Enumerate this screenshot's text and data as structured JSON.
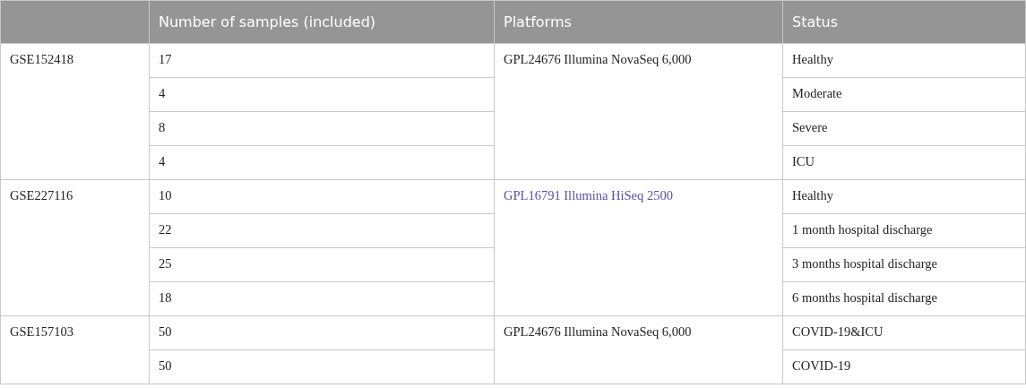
{
  "table": {
    "columns": [
      "Number of samples (included)",
      "Platforms",
      "Status"
    ],
    "groups": [
      {
        "series": "GSE152418",
        "platform": {
          "text": "GPL24676 Illumina NovaSeq 6,000",
          "kind": "text"
        },
        "rows": [
          {
            "samples": "17",
            "status": "Healthy"
          },
          {
            "samples": "4",
            "status": "Moderate"
          },
          {
            "samples": "8",
            "status": "Severe"
          },
          {
            "samples": "4",
            "status": "ICU"
          }
        ]
      },
      {
        "series": "GSE227116",
        "platform": {
          "text": "GPL16791 Illumina HiSeq 2500",
          "kind": "link"
        },
        "rows": [
          {
            "samples": "10",
            "status": "Healthy"
          },
          {
            "samples": "22",
            "status": "1 month hospital discharge"
          },
          {
            "samples": "25",
            "status": "3 months hospital discharge"
          },
          {
            "samples": "18",
            "status": "6 months hospital discharge"
          }
        ]
      },
      {
        "series": "GSE157103",
        "platform": {
          "text": "GPL24676 Illumina NovaSeq 6,000",
          "kind": "text"
        },
        "rows": [
          {
            "samples": "50",
            "status": "COVID-19&ICU"
          },
          {
            "samples": "50",
            "status": "COVID-19"
          }
        ]
      }
    ]
  }
}
